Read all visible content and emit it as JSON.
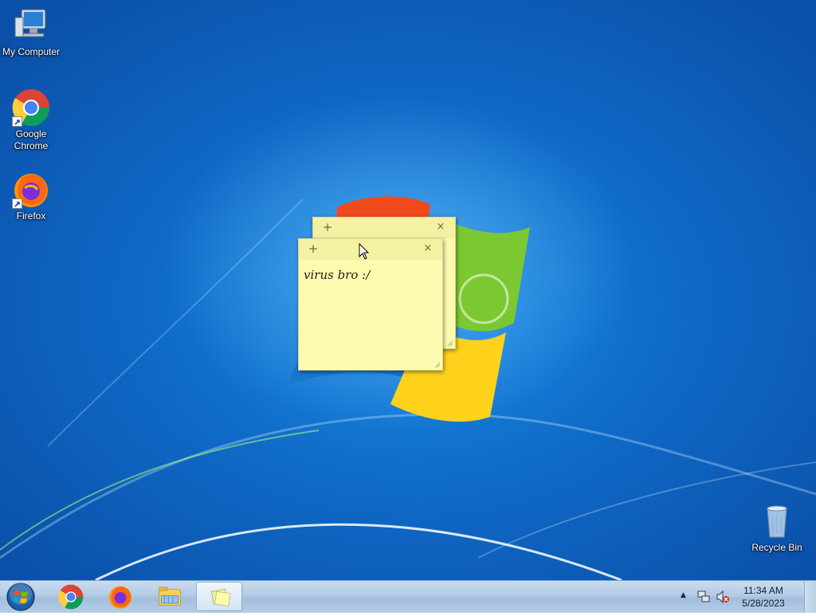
{
  "desktop": {
    "icons": [
      {
        "label": "My Computer",
        "icon": "computer-icon"
      },
      {
        "label": "Google Chrome",
        "label_line1": "Google",
        "label_line2": "Chrome",
        "icon": "chrome-icon"
      },
      {
        "label": "Firefox",
        "icon": "firefox-icon"
      },
      {
        "label": "Recycle Bin",
        "icon": "recycle-bin-icon"
      }
    ]
  },
  "sticky_notes": [
    {
      "text": "",
      "new_note_symbol": "+",
      "close_symbol": "×"
    },
    {
      "text": "virus bro :/",
      "new_note_symbol": "+",
      "close_symbol": "×"
    }
  ],
  "taskbar": {
    "start_icon": "windows-orb-icon",
    "pinned": [
      {
        "icon": "chrome-icon"
      },
      {
        "icon": "firefox-icon"
      },
      {
        "icon": "file-explorer-icon"
      },
      {
        "icon": "sticky-notes-icon",
        "active": true
      }
    ],
    "tray": {
      "show_hidden_symbol": "▲",
      "network_icon": "network-icon",
      "volume_icon": "volume-muted-icon",
      "time": "11:34 AM",
      "date": "5/28/2023"
    }
  },
  "colors": {
    "wallpaper": "#0f6bc8",
    "note_yellow": "#fdfbb0",
    "taskbar": "#b3cbe4"
  }
}
